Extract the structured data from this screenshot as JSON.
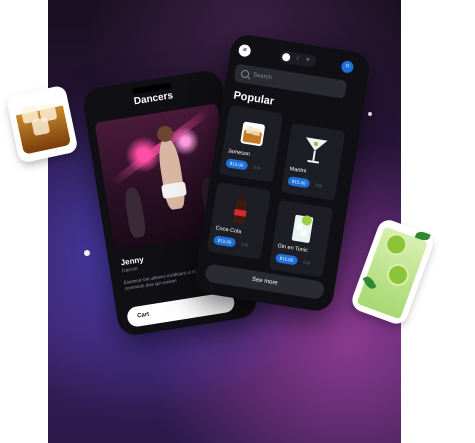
{
  "colors": {
    "accent": "#1f6fd8",
    "phone_bg": "#101014",
    "card_bg": "#1d1d25",
    "text": "#ffffff",
    "muted": "#8a8a95"
  },
  "left_phone": {
    "title": "Dancers",
    "person_name": "Jenny",
    "person_subtitle": "Dancer",
    "description": "Eiusmod sint ullamco incididunt ut magna consectetur commodo duis qui veniam",
    "cart_label": "Cart"
  },
  "right_phone": {
    "menu_icon": "menu-icon",
    "toggle_labels": [
      "☾",
      "☀"
    ],
    "search_placeholder": "Search",
    "section_title": "Popular",
    "cards": [
      {
        "name": "Jameson",
        "price": "$10.00",
        "meta": "0.5l"
      },
      {
        "name": "Martini",
        "price": "$15.00",
        "meta": "0.5l"
      },
      {
        "name": "Coca-Cola",
        "price": "$10.00",
        "meta": "0.5l"
      },
      {
        "name": "Gin en Tonic",
        "price": "$15.00",
        "meta": "0.5l"
      }
    ],
    "see_more": "See more"
  }
}
